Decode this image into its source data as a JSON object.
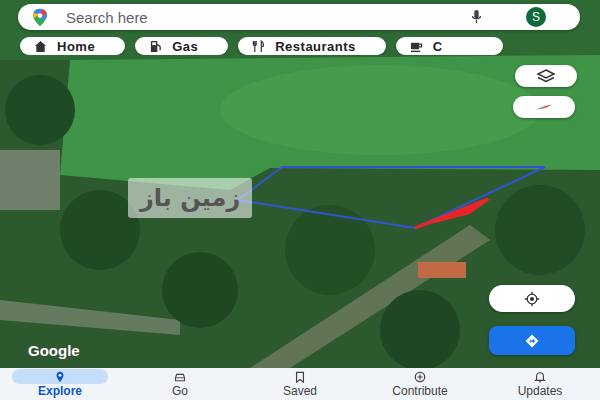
{
  "search": {
    "placeholder": "Search here",
    "avatar": "S"
  },
  "chips": [
    {
      "label": "Home"
    },
    {
      "label": "Gas"
    },
    {
      "label": "Restaurants"
    },
    {
      "label": "C"
    }
  ],
  "map": {
    "attribution": "Google",
    "watermark": "زمین باز"
  },
  "nav": [
    {
      "label": "Explore",
      "selected": true
    },
    {
      "label": "Go",
      "selected": false
    },
    {
      "label": "Saved",
      "selected": false
    },
    {
      "label": "Contribute",
      "selected": false
    },
    {
      "label": "Updates",
      "selected": false
    }
  ]
}
